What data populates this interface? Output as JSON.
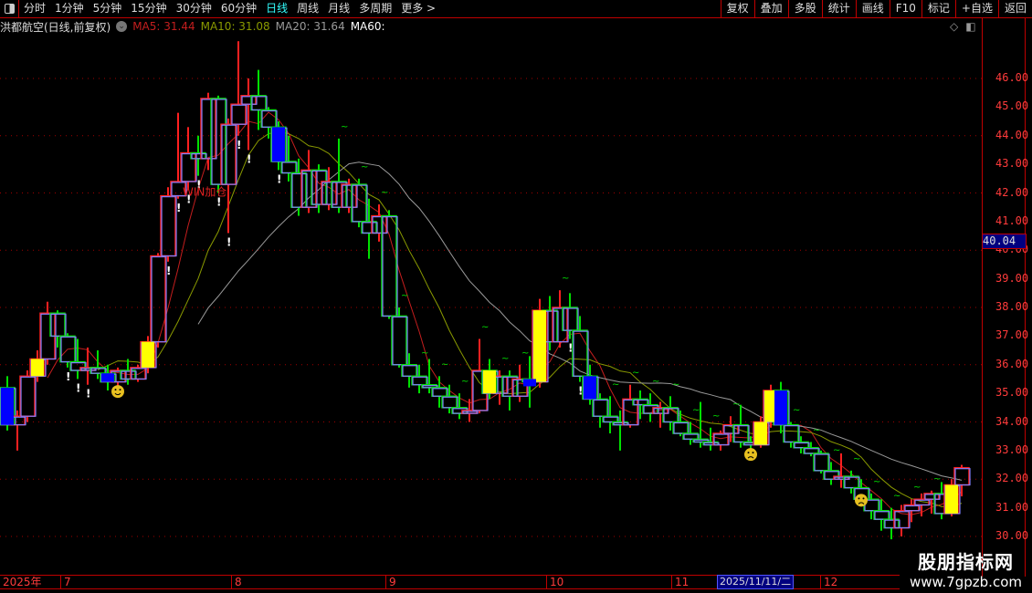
{
  "toolbar": {
    "periods": [
      "分时",
      "1分钟",
      "5分钟",
      "15分钟",
      "30分钟",
      "60分钟",
      "日线",
      "周线",
      "月线",
      "多周期",
      "更多 >"
    ],
    "active_period": "日线",
    "right_buttons": [
      "复权",
      "叠加",
      "多股",
      "统计",
      "画线",
      "F10",
      "标记",
      "+自选",
      "返回"
    ]
  },
  "info": {
    "title": "洪都航空(日线,前复权)",
    "ma5": "MA5: 31.44",
    "ma10": "MA10: 31.08",
    "ma20": "MA20: 31.64",
    "ma60": "MA60:",
    "colors": {
      "ma5": "#c41e1e",
      "ma10": "#8a9a00",
      "ma20": "#9a9a9a",
      "ma60": "#ffffff"
    }
  },
  "signal_label": "WIN加仓",
  "yaxis": {
    "ticks": [
      "46.00",
      "45.00",
      "44.00",
      "43.00",
      "42.00",
      "41.00",
      "40.00",
      "39.00",
      "38.00",
      "37.00",
      "36.00",
      "35.00",
      "34.00",
      "33.00",
      "32.00",
      "31.00",
      "30.00"
    ],
    "current_price": "40.04"
  },
  "xaxis": {
    "labels": [
      "2025年",
      "7",
      "8",
      "9",
      "10",
      "11",
      "12"
    ],
    "cursor_date": "2025/11/11/二"
  },
  "watermark": {
    "line1": "股朋指标网",
    "line2": "www.7gpzb.com"
  },
  "chart_data": {
    "type": "candlestick",
    "ylim": [
      29.6,
      47.8
    ],
    "grid": "dotted horizontal",
    "colors": {
      "up": "#ff2020",
      "down": "#00e000",
      "box": "#8080ff",
      "yellow": "#ffff00",
      "blue": "#0000ff"
    },
    "candles": [
      [
        35.2,
        35.6,
        33.7,
        33.9
      ],
      [
        33.9,
        34.4,
        33.0,
        34.2
      ],
      [
        34.2,
        35.8,
        34.0,
        35.6
      ],
      [
        35.6,
        36.5,
        35.4,
        36.2
      ],
      [
        36.2,
        38.2,
        36.0,
        37.8
      ],
      [
        37.8,
        37.9,
        36.6,
        37.0
      ],
      [
        37.0,
        37.1,
        35.9,
        36.1
      ],
      [
        36.1,
        36.9,
        35.5,
        35.8
      ],
      [
        35.8,
        36.6,
        35.3,
        35.9
      ],
      [
        35.9,
        36.5,
        35.5,
        35.7
      ],
      [
        35.7,
        36.0,
        35.1,
        35.4
      ],
      [
        35.4,
        35.9,
        35.0,
        35.8
      ],
      [
        35.8,
        36.2,
        35.3,
        35.5
      ],
      [
        35.5,
        36.0,
        35.4,
        35.9
      ],
      [
        35.9,
        37.0,
        35.7,
        36.8
      ],
      [
        36.8,
        39.9,
        36.6,
        39.8
      ],
      [
        39.8,
        42.2,
        39.6,
        41.9
      ],
      [
        41.9,
        44.8,
        41.8,
        42.4
      ],
      [
        42.4,
        44.3,
        42.1,
        43.4
      ],
      [
        43.4,
        44.0,
        42.6,
        43.2
      ],
      [
        43.2,
        45.5,
        42.8,
        45.3
      ],
      [
        45.3,
        45.4,
        42.0,
        42.3
      ],
      [
        42.3,
        44.6,
        40.6,
        44.4
      ],
      [
        44.4,
        47.3,
        44.0,
        45.1
      ],
      [
        45.1,
        46.0,
        43.5,
        45.4
      ],
      [
        45.4,
        46.3,
        44.2,
        44.9
      ],
      [
        44.9,
        45.0,
        43.9,
        44.3
      ],
      [
        44.3,
        44.5,
        42.8,
        43.1
      ],
      [
        43.1,
        44.0,
        42.4,
        42.7
      ],
      [
        42.7,
        43.2,
        41.2,
        41.5
      ],
      [
        41.5,
        43.5,
        41.3,
        42.8
      ],
      [
        42.8,
        43.0,
        41.3,
        41.6
      ],
      [
        41.6,
        42.9,
        41.4,
        42.4
      ],
      [
        42.4,
        43.9,
        41.3,
        41.5
      ],
      [
        41.5,
        42.5,
        41.3,
        42.3
      ],
      [
        42.3,
        42.5,
        40.8,
        41.0
      ],
      [
        41.0,
        41.8,
        39.7,
        40.6
      ],
      [
        40.6,
        41.6,
        40.3,
        41.2
      ],
      [
        41.2,
        41.4,
        37.6,
        37.7
      ],
      [
        37.7,
        38.0,
        35.9,
        36.0
      ],
      [
        36.0,
        36.4,
        35.2,
        35.6
      ],
      [
        35.6,
        36.0,
        35.0,
        35.3
      ],
      [
        35.3,
        36.2,
        35.0,
        35.2
      ],
      [
        35.2,
        35.6,
        34.5,
        34.9
      ],
      [
        34.9,
        35.3,
        34.3,
        34.5
      ],
      [
        34.5,
        35.0,
        34.1,
        34.3
      ],
      [
        34.3,
        34.8,
        34.0,
        34.4
      ],
      [
        34.4,
        36.9,
        34.3,
        35.8
      ],
      [
        35.8,
        36.2,
        34.8,
        35.0
      ],
      [
        35.0,
        35.8,
        34.6,
        35.6
      ],
      [
        35.6,
        35.8,
        34.4,
        34.9
      ],
      [
        34.9,
        36.0,
        34.7,
        35.5
      ],
      [
        35.5,
        36.3,
        34.5,
        35.4
      ],
      [
        35.4,
        38.3,
        35.2,
        37.9
      ],
      [
        37.9,
        38.4,
        36.5,
        36.8
      ],
      [
        36.8,
        38.6,
        36.6,
        38.0
      ],
      [
        38.0,
        38.5,
        36.9,
        37.2
      ],
      [
        37.2,
        37.7,
        35.4,
        35.6
      ],
      [
        35.6,
        36.0,
        34.6,
        34.8
      ],
      [
        34.8,
        35.0,
        33.8,
        34.2
      ],
      [
        34.2,
        34.9,
        33.6,
        34.0
      ],
      [
        34.0,
        34.4,
        33.0,
        33.9
      ],
      [
        33.9,
        35.3,
        33.8,
        34.8
      ],
      [
        34.8,
        35.1,
        34.1,
        34.6
      ],
      [
        34.6,
        35.0,
        34.0,
        34.3
      ],
      [
        34.3,
        34.7,
        33.8,
        34.5
      ],
      [
        34.5,
        34.9,
        33.7,
        34.0
      ],
      [
        34.0,
        34.4,
        33.5,
        33.6
      ],
      [
        33.6,
        34.0,
        33.2,
        33.4
      ],
      [
        33.4,
        34.7,
        33.1,
        33.3
      ],
      [
        33.3,
        33.8,
        33.0,
        33.2
      ],
      [
        33.2,
        33.7,
        33.0,
        33.6
      ],
      [
        33.6,
        34.2,
        33.3,
        33.9
      ],
      [
        33.9,
        34.6,
        33.1,
        33.3
      ],
      [
        33.3,
        33.5,
        32.8,
        33.2
      ],
      [
        33.2,
        34.2,
        33.1,
        34.0
      ],
      [
        34.0,
        35.3,
        33.8,
        35.1
      ],
      [
        35.1,
        35.4,
        33.6,
        33.9
      ],
      [
        33.9,
        34.0,
        33.1,
        33.3
      ],
      [
        33.3,
        33.5,
        32.9,
        33.1
      ],
      [
        33.1,
        33.3,
        32.8,
        32.9
      ],
      [
        32.9,
        33.0,
        32.2,
        32.3
      ],
      [
        32.3,
        32.6,
        31.8,
        32.0
      ],
      [
        32.0,
        32.9,
        31.7,
        32.1
      ],
      [
        32.1,
        32.3,
        31.5,
        31.7
      ],
      [
        31.7,
        32.0,
        31.2,
        31.3
      ],
      [
        31.3,
        31.5,
        30.6,
        30.9
      ],
      [
        30.9,
        31.3,
        30.2,
        30.6
      ],
      [
        30.6,
        31.0,
        29.9,
        30.3
      ],
      [
        30.3,
        31.1,
        30.0,
        30.9
      ],
      [
        30.9,
        31.3,
        30.5,
        31.1
      ],
      [
        31.1,
        31.5,
        30.7,
        31.3
      ],
      [
        31.3,
        31.6,
        30.8,
        31.5
      ],
      [
        31.5,
        31.9,
        30.6,
        30.8
      ],
      [
        30.8,
        32.0,
        30.7,
        31.8
      ],
      [
        31.8,
        32.5,
        31.4,
        32.4
      ]
    ],
    "yellow_signals": [
      3,
      14,
      48,
      53,
      75,
      76,
      94
    ],
    "blue_signals": [
      0,
      10,
      27,
      52,
      58,
      77
    ],
    "smile_signals": [
      11
    ],
    "sad_signals": [
      74,
      85
    ],
    "exclaim_signals": [
      6,
      7,
      8,
      16,
      17,
      18,
      19,
      21,
      22,
      23,
      24,
      27,
      56,
      57
    ],
    "tilde_signals": [
      33,
      35,
      37,
      39,
      41,
      43,
      45,
      47,
      49,
      51,
      55,
      60,
      62,
      64,
      66,
      68,
      70,
      72,
      78,
      80,
      82,
      84,
      86,
      88,
      90,
      92
    ],
    "label_signal_index": 18
  }
}
